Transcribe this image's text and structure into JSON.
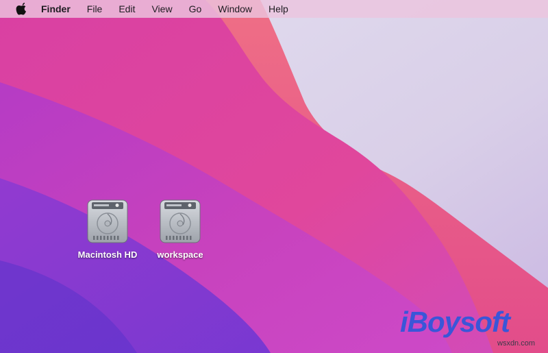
{
  "menubar": {
    "apple_icon": "apple-logo-icon",
    "app_name": "Finder",
    "items": [
      "File",
      "Edit",
      "View",
      "Go",
      "Window",
      "Help"
    ]
  },
  "desktop": {
    "disks": [
      {
        "label": "Macintosh HD",
        "icon": "hard-drive-icon"
      },
      {
        "label": "workspace",
        "icon": "hard-drive-icon"
      }
    ]
  },
  "watermark": {
    "brand": "iBoysoft",
    "site": "wsxdn.com"
  },
  "colors": {
    "menubar_bg": "#ecc4de",
    "wallpaper_magenta": "#d6389d",
    "wallpaper_violet": "#7b3bd0",
    "wallpaper_light": "#dcd3ea",
    "brand_blue": "#3a56d8"
  }
}
